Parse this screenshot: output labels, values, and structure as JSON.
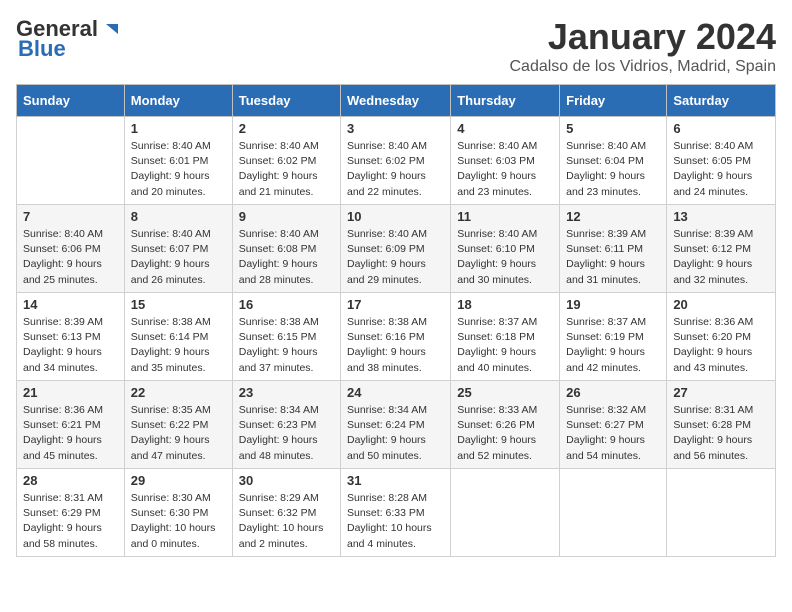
{
  "header": {
    "logo_general": "General",
    "logo_blue": "Blue",
    "month": "January 2024",
    "location": "Cadalso de los Vidrios, Madrid, Spain"
  },
  "days_of_week": [
    "Sunday",
    "Monday",
    "Tuesday",
    "Wednesday",
    "Thursday",
    "Friday",
    "Saturday"
  ],
  "weeks": [
    [
      {
        "day": "",
        "content": ""
      },
      {
        "day": "1",
        "content": "Sunrise: 8:40 AM\nSunset: 6:01 PM\nDaylight: 9 hours\nand 20 minutes."
      },
      {
        "day": "2",
        "content": "Sunrise: 8:40 AM\nSunset: 6:02 PM\nDaylight: 9 hours\nand 21 minutes."
      },
      {
        "day": "3",
        "content": "Sunrise: 8:40 AM\nSunset: 6:02 PM\nDaylight: 9 hours\nand 22 minutes."
      },
      {
        "day": "4",
        "content": "Sunrise: 8:40 AM\nSunset: 6:03 PM\nDaylight: 9 hours\nand 23 minutes."
      },
      {
        "day": "5",
        "content": "Sunrise: 8:40 AM\nSunset: 6:04 PM\nDaylight: 9 hours\nand 23 minutes."
      },
      {
        "day": "6",
        "content": "Sunrise: 8:40 AM\nSunset: 6:05 PM\nDaylight: 9 hours\nand 24 minutes."
      }
    ],
    [
      {
        "day": "7",
        "content": "Sunrise: 8:40 AM\nSunset: 6:06 PM\nDaylight: 9 hours\nand 25 minutes."
      },
      {
        "day": "8",
        "content": "Sunrise: 8:40 AM\nSunset: 6:07 PM\nDaylight: 9 hours\nand 26 minutes."
      },
      {
        "day": "9",
        "content": "Sunrise: 8:40 AM\nSunset: 6:08 PM\nDaylight: 9 hours\nand 28 minutes."
      },
      {
        "day": "10",
        "content": "Sunrise: 8:40 AM\nSunset: 6:09 PM\nDaylight: 9 hours\nand 29 minutes."
      },
      {
        "day": "11",
        "content": "Sunrise: 8:40 AM\nSunset: 6:10 PM\nDaylight: 9 hours\nand 30 minutes."
      },
      {
        "day": "12",
        "content": "Sunrise: 8:39 AM\nSunset: 6:11 PM\nDaylight: 9 hours\nand 31 minutes."
      },
      {
        "day": "13",
        "content": "Sunrise: 8:39 AM\nSunset: 6:12 PM\nDaylight: 9 hours\nand 32 minutes."
      }
    ],
    [
      {
        "day": "14",
        "content": "Sunrise: 8:39 AM\nSunset: 6:13 PM\nDaylight: 9 hours\nand 34 minutes."
      },
      {
        "day": "15",
        "content": "Sunrise: 8:38 AM\nSunset: 6:14 PM\nDaylight: 9 hours\nand 35 minutes."
      },
      {
        "day": "16",
        "content": "Sunrise: 8:38 AM\nSunset: 6:15 PM\nDaylight: 9 hours\nand 37 minutes."
      },
      {
        "day": "17",
        "content": "Sunrise: 8:38 AM\nSunset: 6:16 PM\nDaylight: 9 hours\nand 38 minutes."
      },
      {
        "day": "18",
        "content": "Sunrise: 8:37 AM\nSunset: 6:18 PM\nDaylight: 9 hours\nand 40 minutes."
      },
      {
        "day": "19",
        "content": "Sunrise: 8:37 AM\nSunset: 6:19 PM\nDaylight: 9 hours\nand 42 minutes."
      },
      {
        "day": "20",
        "content": "Sunrise: 8:36 AM\nSunset: 6:20 PM\nDaylight: 9 hours\nand 43 minutes."
      }
    ],
    [
      {
        "day": "21",
        "content": "Sunrise: 8:36 AM\nSunset: 6:21 PM\nDaylight: 9 hours\nand 45 minutes."
      },
      {
        "day": "22",
        "content": "Sunrise: 8:35 AM\nSunset: 6:22 PM\nDaylight: 9 hours\nand 47 minutes."
      },
      {
        "day": "23",
        "content": "Sunrise: 8:34 AM\nSunset: 6:23 PM\nDaylight: 9 hours\nand 48 minutes."
      },
      {
        "day": "24",
        "content": "Sunrise: 8:34 AM\nSunset: 6:24 PM\nDaylight: 9 hours\nand 50 minutes."
      },
      {
        "day": "25",
        "content": "Sunrise: 8:33 AM\nSunset: 6:26 PM\nDaylight: 9 hours\nand 52 minutes."
      },
      {
        "day": "26",
        "content": "Sunrise: 8:32 AM\nSunset: 6:27 PM\nDaylight: 9 hours\nand 54 minutes."
      },
      {
        "day": "27",
        "content": "Sunrise: 8:31 AM\nSunset: 6:28 PM\nDaylight: 9 hours\nand 56 minutes."
      }
    ],
    [
      {
        "day": "28",
        "content": "Sunrise: 8:31 AM\nSunset: 6:29 PM\nDaylight: 9 hours\nand 58 minutes."
      },
      {
        "day": "29",
        "content": "Sunrise: 8:30 AM\nSunset: 6:30 PM\nDaylight: 10 hours\nand 0 minutes."
      },
      {
        "day": "30",
        "content": "Sunrise: 8:29 AM\nSunset: 6:32 PM\nDaylight: 10 hours\nand 2 minutes."
      },
      {
        "day": "31",
        "content": "Sunrise: 8:28 AM\nSunset: 6:33 PM\nDaylight: 10 hours\nand 4 minutes."
      },
      {
        "day": "",
        "content": ""
      },
      {
        "day": "",
        "content": ""
      },
      {
        "day": "",
        "content": ""
      }
    ]
  ]
}
